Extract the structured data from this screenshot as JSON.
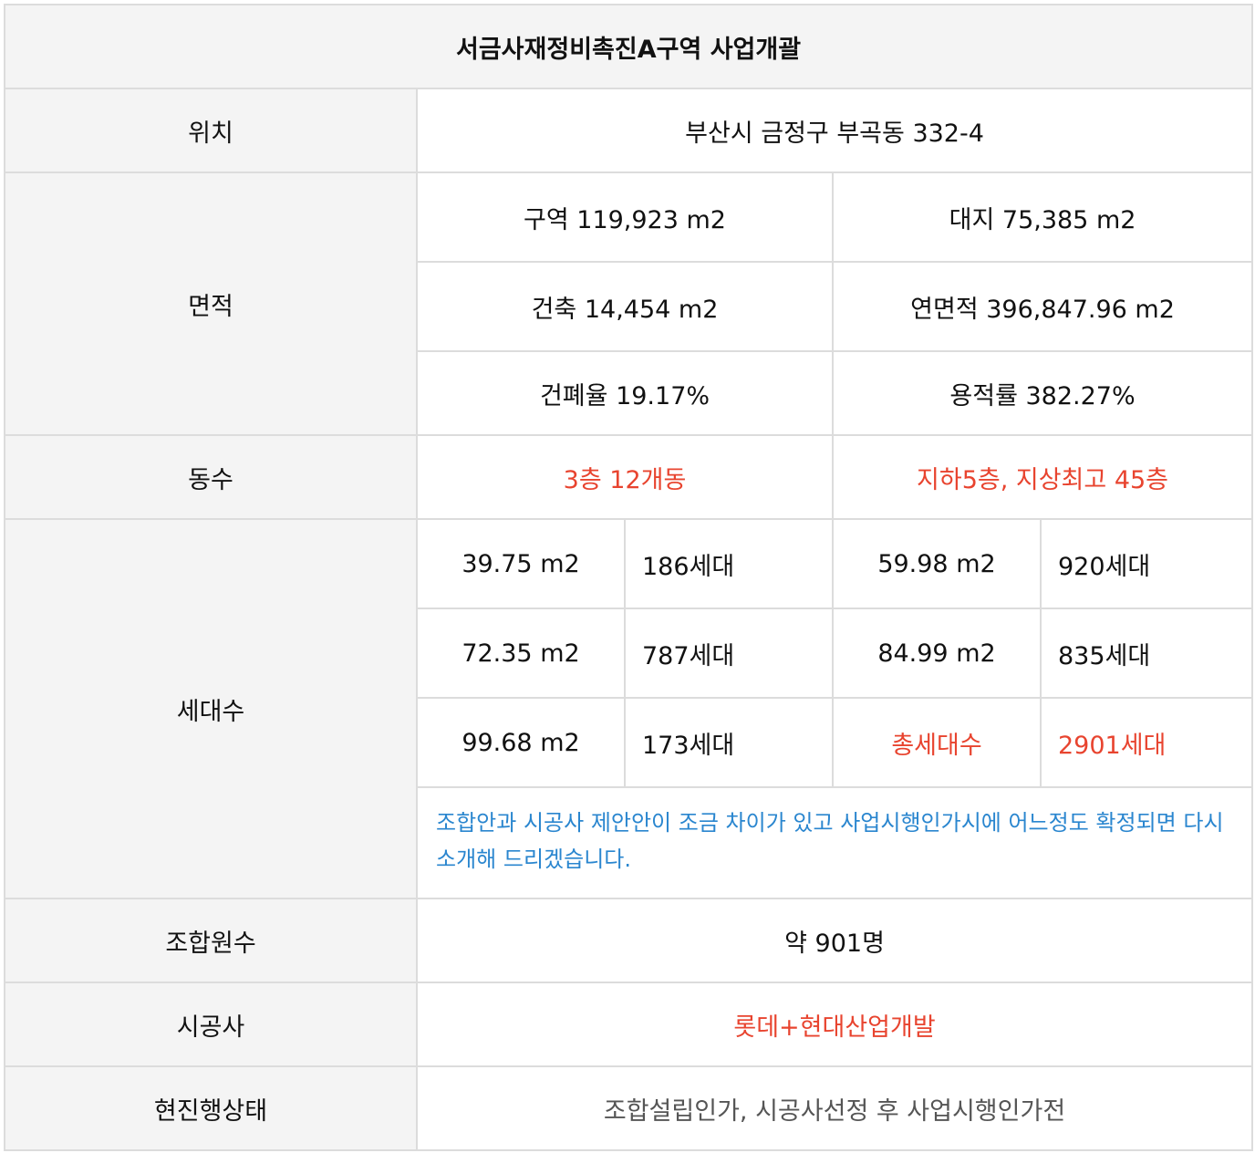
{
  "title": "서금사재정비촉진A구역 사업개괄",
  "location": {
    "label": "위치",
    "value": "부산시 금정구 부곡동 332-4"
  },
  "area": {
    "label": "면적",
    "rows": [
      [
        "구역 119,923 m2",
        "대지 75,385 m2"
      ],
      [
        "건축 14,454 m2",
        "연면적 396,847.96 m2"
      ],
      [
        "건폐율 19.17%",
        "용적률 382.27%"
      ]
    ]
  },
  "buildings": {
    "label": "동수",
    "left": "3층 12개동",
    "right": "지하5층, 지상최고 45층"
  },
  "households": {
    "label": "세대수",
    "rows": [
      [
        "39.75 m2",
        "186세대",
        "59.98 m2",
        "920세대"
      ],
      [
        "72.35 m2",
        "787세대",
        "84.99 m2",
        "835세대"
      ],
      [
        "99.68 m2",
        "173세대",
        "총세대수",
        "2901세대"
      ]
    ],
    "note": "조합안과 시공사 제안안이 조금 차이가 있고 사업시행인가시에  어느정도 확정되면 다시 소개해 드리겠습니다."
  },
  "members": {
    "label": "조합원수",
    "value": "약 901명"
  },
  "contractor": {
    "label": "시공사",
    "value": "롯데+현대산업개발"
  },
  "status": {
    "label": "현진행상태",
    "value": "조합설립인가, 시공사선정 후 사업시행인가전"
  },
  "colors": {
    "accent_red": "#e8442f",
    "label_blue": "#2a86cf",
    "header_bg": "#f4f4f4",
    "border": "#dcdcdc"
  }
}
